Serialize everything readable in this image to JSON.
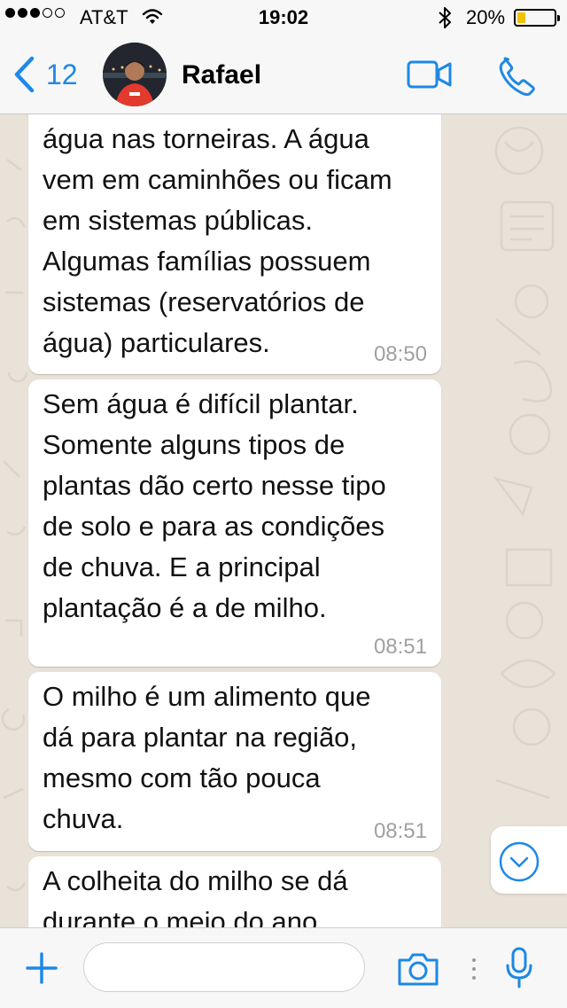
{
  "status_bar": {
    "carrier": "AT&T",
    "time": "19:02",
    "battery_percent": "20%",
    "signal_bars_filled": 3,
    "signal_bars_total": 5
  },
  "header": {
    "back_count": "12",
    "contact_name": "Rafael"
  },
  "messages": [
    {
      "text": "água nas torneiras. A água\nvem em caminhões ou ficam\nem sistemas públicas.\nAlgumas famílias possuem\nsistemas (reservatórios de\nágua) particulares.",
      "time": "08:50"
    },
    {
      "text": "Sem água é difícil plantar.\nSomente alguns tipos de\nplantas dão certo nesse tipo\nde solo e para as condições\nde chuva. E a principal\nplantação é a de milho.",
      "time": "08:51"
    },
    {
      "text": "O milho é um alimento que\ndá para plantar na região,\nmesmo com tão pouca\nchuva.",
      "time": "08:51"
    },
    {
      "text": "A colheita do milho se dá\ndurante o meio do ano",
      "time": ""
    }
  ],
  "input": {
    "value": "",
    "placeholder": ""
  },
  "icons": {
    "back": "chevron-left-icon",
    "video": "video-camera-icon",
    "call": "phone-icon",
    "scroll": "chevron-down-circle-icon",
    "attach": "plus-icon",
    "camera": "camera-icon",
    "mic": "microphone-icon"
  },
  "colors": {
    "accent": "#1E88E5",
    "battery_fill": "#F2C100",
    "bubble": "#FFFFFF",
    "timestamp": "#A0A0A0"
  }
}
